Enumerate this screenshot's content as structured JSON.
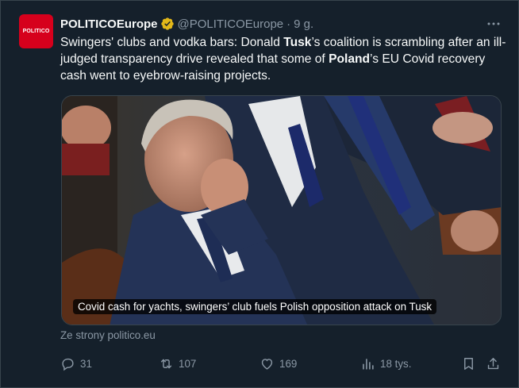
{
  "account": {
    "avatar_text": "POLITICO",
    "avatar_color": "#d6001c",
    "display_name": "POLITICOEurope",
    "handle": "@POLITICOEurope",
    "separator": "·",
    "time": "9 g."
  },
  "tweet": {
    "text_parts": [
      {
        "text": "Swingers' clubs and vodka bars: Donald ",
        "bold": false
      },
      {
        "text": "Tusk",
        "bold": true
      },
      {
        "text": "’s coalition is scrambling after an ill-judged transparency drive revealed that some of ",
        "bold": false
      },
      {
        "text": "Poland",
        "bold": true
      },
      {
        "text": "’s EU Covid recovery cash went to eyebrow-raising projects.",
        "bold": false
      }
    ]
  },
  "card": {
    "caption": "Covid cash for yachts, swingers’ club fuels Polish opposition attack on Tusk",
    "source": "Ze strony politico.eu"
  },
  "actions": {
    "replies": "31",
    "reposts": "107",
    "likes": "169",
    "views": "18 tys."
  },
  "colors": {
    "background": "#15202b",
    "text": "#f7f9f9",
    "muted": "#8b98a5",
    "verified": "#e2b719"
  }
}
